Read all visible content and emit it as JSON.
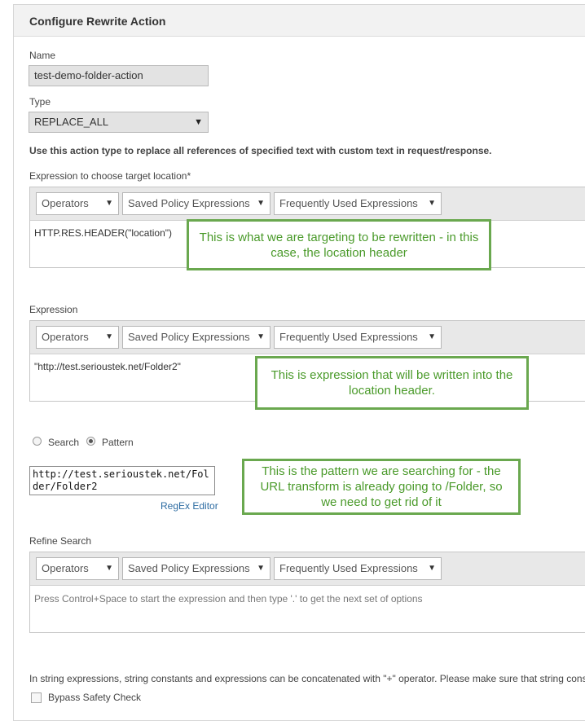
{
  "panel": {
    "title": "Configure Rewrite Action"
  },
  "name_field": {
    "label": "Name",
    "value": "test-demo-folder-action"
  },
  "type_field": {
    "label": "Type",
    "value": "REPLACE_ALL"
  },
  "type_description": "Use this action type to replace all references of specified text with custom text in request/response.",
  "toolbar": {
    "operators": "Operators",
    "saved_policy": "Saved Policy Expressions",
    "frequently_used": "Frequently Used Expressions"
  },
  "target_expression": {
    "label": "Expression to choose target location*",
    "value": "HTTP.RES.HEADER(\"location\")"
  },
  "expression": {
    "label": "Expression",
    "value": "\"http://test.serioustek.net/Folder2\""
  },
  "search_mode": {
    "search_label": "Search",
    "pattern_label": "Pattern",
    "selected": "Pattern"
  },
  "pattern": {
    "value": "http://test.serioustek.net/Folder/Folder2",
    "regex_link": "RegEx Editor"
  },
  "refine_search": {
    "label": "Refine Search",
    "placeholder": "Press Control+Space to start the expression and then type '.' to get the next set of options"
  },
  "footer_note": "In string expressions, string constants and expressions can be concatenated with \"+\" operator. Please make sure that string consta",
  "bypass_safety": {
    "label": "Bypass Safety Check",
    "checked": false
  },
  "callouts": {
    "target": "This is what we are targeting to be rewritten - in this case, the location header",
    "expression": "This is expression that will be written into the location header.",
    "pattern": "This is the pattern we are searching for - the URL transform is already going to /Folder, so we need to get rid of it"
  },
  "colors": {
    "callout_border": "#6aa84f",
    "callout_text": "#4a9a2a",
    "link": "#2d6ca2"
  }
}
